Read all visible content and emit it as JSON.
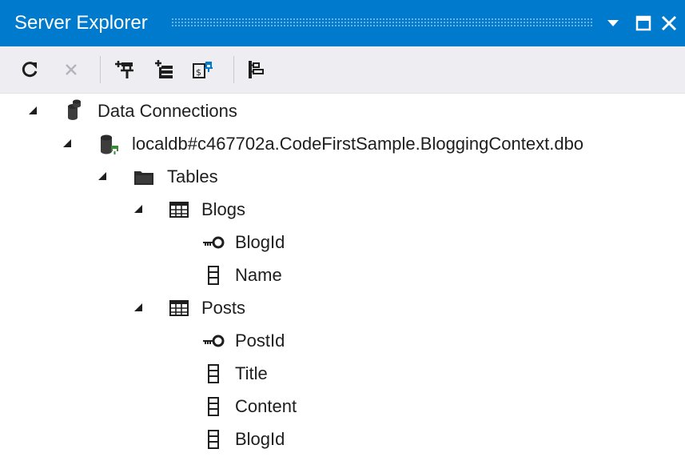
{
  "panel": {
    "title": "Server Explorer",
    "title_buttons": [
      {
        "icon": "chevron-down-icon"
      },
      {
        "icon": "maximize-icon"
      },
      {
        "icon": "close-icon"
      }
    ]
  },
  "toolbar": {
    "buttons": [
      {
        "icon": "refresh-icon",
        "enabled": true
      },
      {
        "icon": "stop-icon",
        "enabled": false
      },
      {
        "icon": "connect-to-database-icon",
        "enabled": true
      },
      {
        "icon": "connect-to-server-icon",
        "enabled": true
      },
      {
        "icon": "connect-to-sharepoint-icon",
        "enabled": true
      },
      {
        "icon": "properties-icon",
        "enabled": true
      }
    ]
  },
  "tree": {
    "data_connections": {
      "label": "Data Connections",
      "icon": "data-connections-icon",
      "expanded": true
    },
    "connection": {
      "label": "localdb#c467702a.CodeFirstSample.BloggingContext.dbo",
      "icon": "database-connection-icon",
      "expanded": true
    },
    "tables": {
      "label": "Tables",
      "icon": "folder-icon",
      "expanded": true
    },
    "blogs": {
      "label": "Blogs",
      "icon": "table-icon",
      "expanded": true,
      "columns": [
        {
          "label": "BlogId",
          "icon": "primary-key-icon"
        },
        {
          "label": "Name",
          "icon": "column-icon"
        }
      ]
    },
    "posts": {
      "label": "Posts",
      "icon": "table-icon",
      "expanded": true,
      "columns": [
        {
          "label": "PostId",
          "icon": "primary-key-icon"
        },
        {
          "label": "Title",
          "icon": "column-icon"
        },
        {
          "label": "Content",
          "icon": "column-icon"
        },
        {
          "label": "BlogId",
          "icon": "column-icon"
        }
      ]
    }
  }
}
